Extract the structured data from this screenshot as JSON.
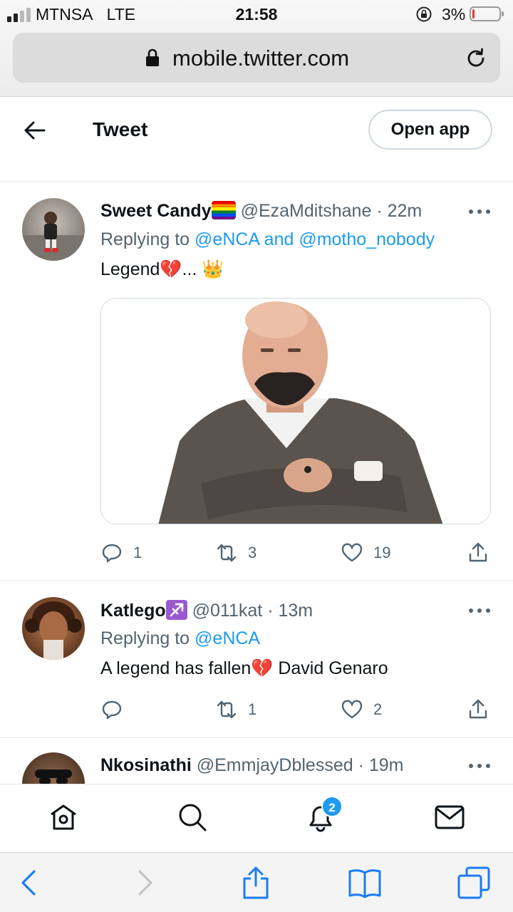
{
  "status_bar": {
    "carrier": "MTNSA",
    "network": "LTE",
    "time": "21:58",
    "battery_percent": "3%",
    "signal_bars": 2
  },
  "browser": {
    "url": "mobile.twitter.com"
  },
  "header": {
    "title": "Tweet",
    "open_app_label": "Open app"
  },
  "tweets": [
    {
      "name": "Sweet Candy",
      "name_emoji": "rainbow-flag",
      "handle": "@EzaMditshane",
      "separator": "·",
      "age": "22m",
      "replying_prefix": "Replying to",
      "replying_mentions": "@eNCA and @motho_nobody",
      "text": "Legend💔... 👑",
      "has_image": true,
      "replies": "1",
      "retweets": "3",
      "likes": "19"
    },
    {
      "name": "Katlego",
      "name_emoji": "sagittarius",
      "handle": "@011kat",
      "separator": "·",
      "age": "13m",
      "replying_prefix": "Replying to",
      "replying_mentions": "@eNCA",
      "text": "A legend has fallen💔 David Genaro",
      "has_image": false,
      "replies": "",
      "retweets": "1",
      "likes": "2"
    },
    {
      "name": "Nkosinathi",
      "handle": "@EmmjayDblessed",
      "separator": "·",
      "age": "19m"
    }
  ],
  "nav": {
    "notifications_badge": "2"
  },
  "colors": {
    "accent": "#1d9bf0",
    "secondary_text": "#536471",
    "primary_text": "#0f1419",
    "divider": "#eff3f4",
    "safari_blue": "#1a7cf5"
  }
}
